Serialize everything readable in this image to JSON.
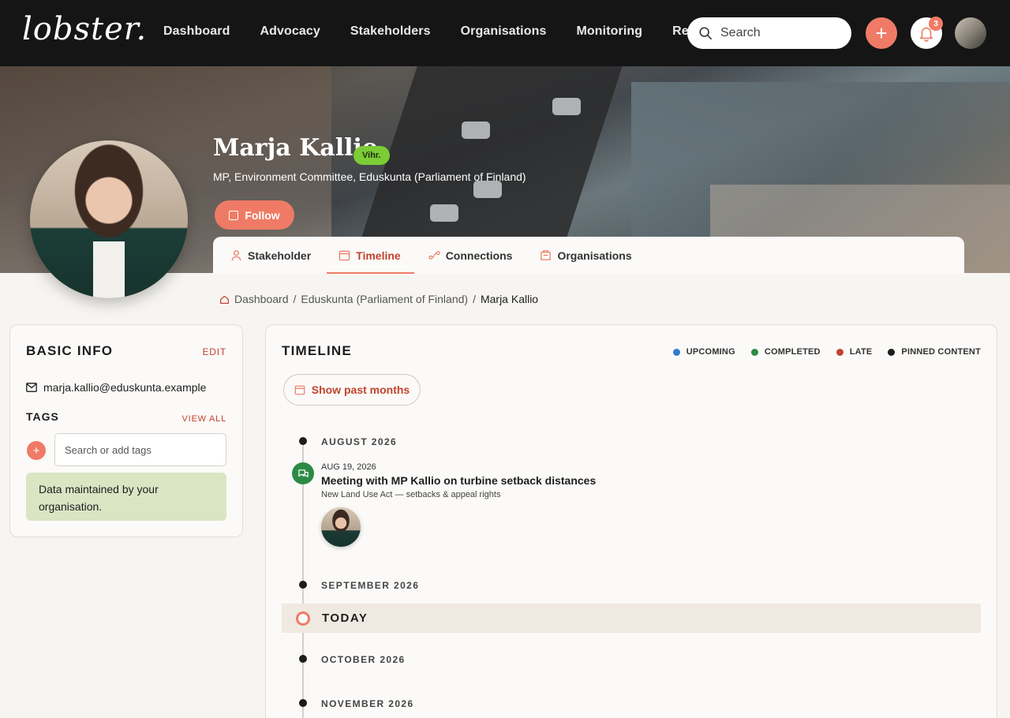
{
  "brand": {
    "logo": "lobster.",
    "accent": "#ef7b66",
    "accent_text": "#c2432e"
  },
  "nav": {
    "items": [
      "Dashboard",
      "Advocacy",
      "Stakeholders",
      "Organisations",
      "Monitoring",
      "Reports"
    ],
    "search_placeholder": "Search",
    "notifications_count": "3"
  },
  "profile": {
    "name": "Marja Kallio",
    "party": "Vihr.",
    "role": "MP, Environment Committee, Eduskunta (Parliament of Finland)",
    "follow_label": "Follow"
  },
  "tabs": [
    {
      "label": "Stakeholder",
      "icon": "person-icon"
    },
    {
      "label": "Timeline",
      "icon": "calendar-icon",
      "active": true
    },
    {
      "label": "Connections",
      "icon": "connections-icon"
    },
    {
      "label": "Organisations",
      "icon": "building-icon"
    }
  ],
  "breadcrumb": [
    "Dashboard",
    "Eduskunta (Parliament of Finland)",
    "Marja Kallio"
  ],
  "basic_info": {
    "title": "BASIC INFO",
    "edit": "EDIT",
    "email": "marja.kallio@eduskunta.example",
    "tags_title": "TAGS",
    "view_all": "VIEW ALL",
    "tag_placeholder": "Search or add tags",
    "maintained": "Data maintained by your organisation."
  },
  "timeline": {
    "title": "TIMELINE",
    "legend": [
      {
        "label": "UPCOMING",
        "color": "#2f7bd1"
      },
      {
        "label": "COMPLETED",
        "color": "#2d8a46"
      },
      {
        "label": "LATE",
        "color": "#c2432e"
      },
      {
        "label": "PINNED CONTENT",
        "color": "#1d1d1d"
      }
    ],
    "past_button": "Show past months",
    "months": [
      "AUGUST 2026",
      "SEPTEMBER 2026",
      "OCTOBER 2026",
      "NOVEMBER 2026"
    ],
    "event": {
      "date": "AUG 19, 2026",
      "title": "Meeting with MP Kallio on turbine setback distances",
      "subtitle": "New Land Use Act — setbacks & appeal rights",
      "status_color": "#2d8a46"
    },
    "today_label": "TODAY"
  }
}
